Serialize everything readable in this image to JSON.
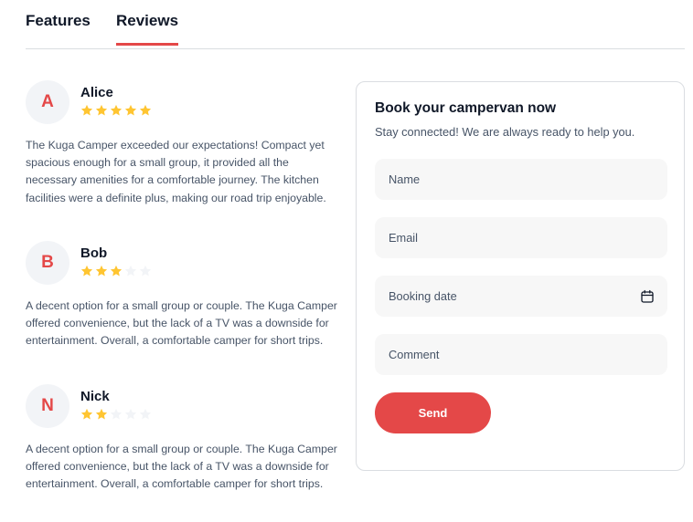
{
  "tabs": [
    {
      "label": "Features",
      "active": false
    },
    {
      "label": "Reviews",
      "active": true
    }
  ],
  "reviews": [
    {
      "initial": "A",
      "name": "Alice",
      "rating": 5,
      "text": "The Kuga Camper exceeded our expectations! Compact yet spacious enough for a small group, it provided all the necessary amenities for a comfortable journey. The kitchen facilities were a definite plus, making our road trip enjoyable."
    },
    {
      "initial": "B",
      "name": "Bob",
      "rating": 3,
      "text": "A decent option for a small group or couple. The Kuga Camper offered convenience, but the lack of a TV was a downside for entertainment. Overall, a comfortable camper for short trips."
    },
    {
      "initial": "N",
      "name": "Nick",
      "rating": 2,
      "text": "A decent option for a small group or couple. The Kuga Camper offered convenience, but the lack of a TV was a downside for entertainment. Overall, a comfortable camper for short trips."
    }
  ],
  "booking": {
    "title": "Book your campervan now",
    "subtitle": "Stay connected! We are always ready to help you.",
    "name_placeholder": "Name",
    "email_placeholder": "Email",
    "date_placeholder": "Booking date",
    "comment_placeholder": "Comment",
    "send_label": "Send",
    "date_icon": "calendar-icon"
  },
  "colors": {
    "accent": "#e44848",
    "star_filled": "#ffc531",
    "star_empty": "#f2f4f7"
  }
}
